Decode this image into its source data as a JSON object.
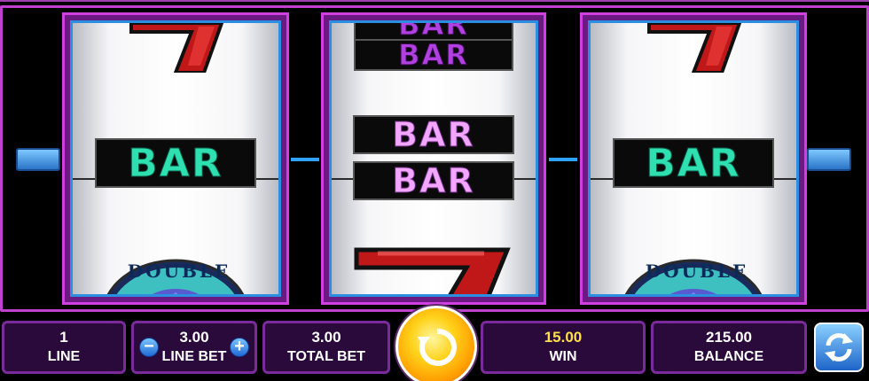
{
  "reels": {
    "left": {
      "top_symbol": "seven-icon",
      "center_label": "BAR",
      "bottom_emblem_text": "DOUBLE"
    },
    "middle": {
      "top_labels": [
        "BAR",
        "BAR"
      ],
      "center_labels": [
        "BAR",
        "BAR"
      ],
      "bottom_symbol": "seven-icon"
    },
    "right": {
      "top_symbol": "seven-icon",
      "center_label": "BAR",
      "bottom_emblem_text": "DOUBLE"
    }
  },
  "panel": {
    "line": {
      "value": "1",
      "label": "LINE"
    },
    "line_bet": {
      "value": "3.00",
      "label": "LINE BET",
      "minus": "−",
      "plus": "+"
    },
    "total_bet": {
      "value": "3.00",
      "label": "TOTAL BET"
    },
    "win": {
      "value": "15.00",
      "label": "WIN"
    },
    "balance": {
      "value": "215.00",
      "label": "BALANCE"
    }
  },
  "colors": {
    "accent": "#c040d0",
    "win": "#ffe04a",
    "bar_teal": "#2ee0b0",
    "bar_pink": "#f3a6ff"
  },
  "icons": {
    "spin": "spin-refresh-icon",
    "autoplay": "autoplay-cycle-icon"
  }
}
